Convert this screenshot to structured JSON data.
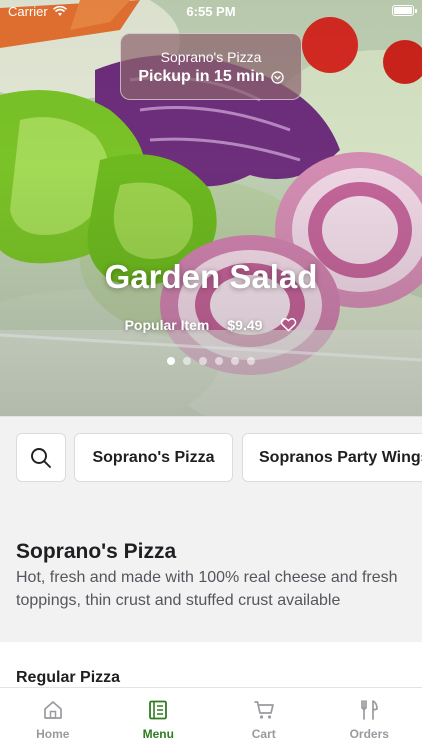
{
  "status_bar": {
    "carrier": "Carrier",
    "time": "6:55 PM"
  },
  "pickup": {
    "restaurant": "Soprano's Pizza",
    "label": "Pickup in 15 min"
  },
  "hero": {
    "title": "Garden Salad",
    "badge": "Popular Item",
    "price": "$9.49",
    "carousel_count": 6,
    "carousel_active_index": 0
  },
  "categories": {
    "items": [
      "Soprano's Pizza",
      "Sopranos Party Wings"
    ]
  },
  "section": {
    "title": "Soprano's Pizza",
    "description": "Hot, fresh and made with 100% real cheese and fresh toppings, thin crust and stuffed crust available",
    "subsection": "Regular Pizza"
  },
  "tabbar": {
    "items": [
      {
        "label": "Home",
        "icon": "home-icon"
      },
      {
        "label": "Menu",
        "icon": "menu-icon"
      },
      {
        "label": "Cart",
        "icon": "cart-icon"
      },
      {
        "label": "Orders",
        "icon": "orders-icon"
      }
    ],
    "active": "Menu"
  },
  "colors": {
    "accent": "#2e7d1f",
    "inactive": "#9a9aa0",
    "pickup_bg": "#8c646e"
  }
}
